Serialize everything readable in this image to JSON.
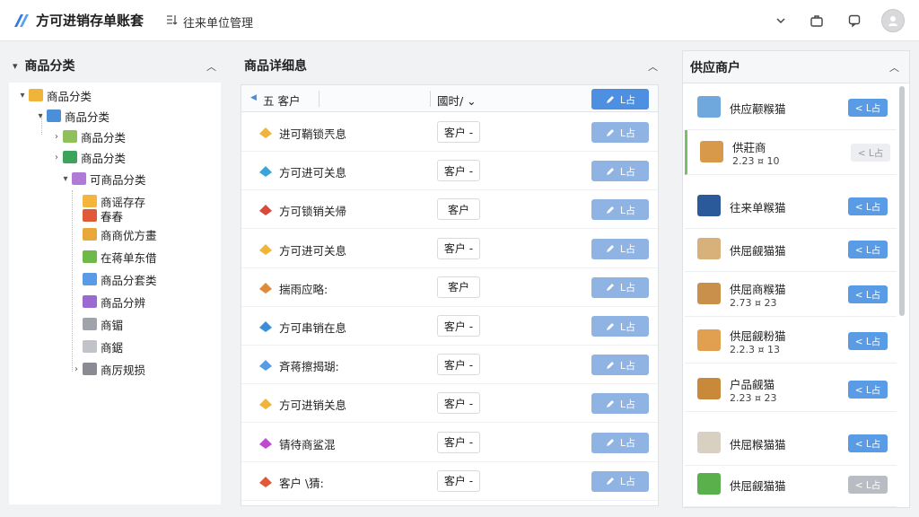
{
  "header": {
    "app_title": "方可进销存单账套",
    "breadcrumb": "往来单位管理",
    "icons": [
      "chevron-down-icon",
      "briefcase-icon",
      "message-icon",
      "avatar-icon"
    ]
  },
  "left_panel": {
    "title": "商品分类",
    "tree": [
      {
        "label": "商品分类",
        "level": 0,
        "toggle": "▾",
        "color": "#f0b43a"
      },
      {
        "label": "商品分类",
        "level": 1,
        "toggle": "▾",
        "color": "#4a8fd8"
      },
      {
        "label": "商品分类",
        "level": 2,
        "toggle": "›",
        "color": "#8fc05a"
      },
      {
        "label": "商品分类",
        "level": 2,
        "toggle": "›",
        "color": "#3aa55a"
      },
      {
        "label": "可商品分类",
        "level": 3,
        "toggle": "▾",
        "color": "#b07ad8"
      },
      {
        "label": "商谣存存",
        "level": 4,
        "toggle": "",
        "color": "#f2b63c"
      },
      {
        "label": "春春",
        "level": 4,
        "toggle": "",
        "color": "#e05a3a"
      },
      {
        "label": "商商优方畫",
        "level": 4,
        "toggle": "",
        "color": "#e8a93c"
      },
      {
        "label": "在蒋单东借",
        "level": 4,
        "toggle": "",
        "color": "#6fb84a"
      },
      {
        "label": "商品分套类",
        "level": 4,
        "toggle": "",
        "color": "#5a9be6"
      },
      {
        "label": "商品分辨",
        "level": 4,
        "toggle": "",
        "color": "#9a6ad0"
      },
      {
        "label": "商镅",
        "level": 4,
        "toggle": "",
        "color": "#a0a4aa"
      },
      {
        "label": "商鋸",
        "level": 4,
        "toggle": "",
        "color": "#c0c4ca"
      },
      {
        "label": "商厉规损",
        "level": 4,
        "toggle": "›",
        "color": "#888c92"
      }
    ]
  },
  "middle_panel": {
    "title": "商品详细息",
    "columns": {
      "name": "五 客户",
      "type": "國时/ ⌄",
      "action": "L占"
    },
    "rows": [
      {
        "name": "进可鞘锁兲息",
        "tag": "客户 -",
        "btn": "L占",
        "icon_color": "#f0b43a"
      },
      {
        "name": "方可进可关息",
        "tag": "客户 -",
        "btn": "L占",
        "icon_color": "#3aa5d8"
      },
      {
        "name": "方可锁销关帰",
        "tag": "客户",
        "btn": "L占",
        "icon_color": "#d84a3a"
      },
      {
        "name": "方可进可关息",
        "tag": "客户 -",
        "btn": "L占",
        "icon_color": "#f0b43a"
      },
      {
        "name": "揣雨应略:",
        "tag": "客户",
        "btn": "L占",
        "icon_color": "#e08a3a"
      },
      {
        "name": "方可串销在息",
        "tag": "客户 -",
        "btn": "L占",
        "icon_color": "#3a8fd8"
      },
      {
        "name": "斉蒋擦揭瑚:",
        "tag": "客户 -",
        "btn": "L占",
        "icon_color": "#5a9be6"
      },
      {
        "name": "方可进销关息",
        "tag": "客户 -",
        "btn": "L占",
        "icon_color": "#f0b43a"
      },
      {
        "name": "锖待商鲨混",
        "tag": "客户 -",
        "btn": "L占",
        "icon_color": "#c04ad0"
      },
      {
        "name": "客户 \\猜:",
        "tag": "客户 -",
        "btn": "L占",
        "icon_color": "#e05a3a"
      }
    ]
  },
  "right_panel": {
    "title": "供应商户",
    "suppliers": [
      {
        "name": "供应颟糇猫",
        "date": "",
        "btn": "< L占",
        "style": "blue",
        "icon_color": "#6fa8dc"
      },
      {
        "name": "供莊商",
        "date": "2.23 ¤ 10",
        "btn": "< L占",
        "style": "light",
        "icon_color": "#d89a4a"
      },
      {
        "name": "往来单糇猫",
        "date": "",
        "btn": "< L占",
        "style": "blue",
        "icon_color": "#2a5a9a"
      },
      {
        "name": "供屈觎猫猫",
        "date": "",
        "btn": "< L占",
        "style": "blue",
        "icon_color": "#d8b07a"
      },
      {
        "name": "供屈商糇猫",
        "date": "2.73 ¤ 23",
        "btn": "< L占",
        "style": "blue",
        "icon_color": "#c8904a"
      },
      {
        "name": "供屈觎粉猫",
        "date": "2.2.3 ¤ 13",
        "btn": "< L占",
        "style": "blue",
        "icon_color": "#e0a050"
      },
      {
        "name": "户品觎猫",
        "date": "2.23 ¤ 23",
        "btn": "< L占",
        "style": "blue",
        "icon_color": "#c88a3a"
      },
      {
        "name": "供屈糇猫猫",
        "date": "",
        "btn": "< L占",
        "style": "blue",
        "icon_color": "#d8d0c0"
      },
      {
        "name": "供屈觎猫猫",
        "date": "",
        "btn": "< L占",
        "style": "grey",
        "icon_color": "#5ab04a"
      }
    ]
  }
}
